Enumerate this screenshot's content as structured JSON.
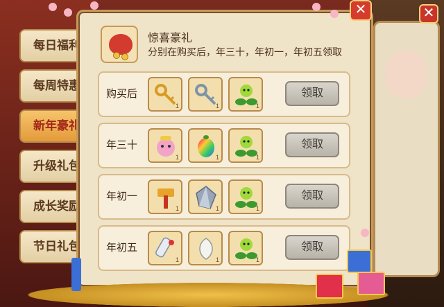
{
  "left_tabs": [
    {
      "label": "每日福利",
      "active": false
    },
    {
      "label": "每周特惠",
      "active": false
    },
    {
      "label": "新年豪礼",
      "active": true
    },
    {
      "label": "升级礼包",
      "active": false
    },
    {
      "label": "成长奖励",
      "active": false
    },
    {
      "label": "节日礼包",
      "active": false
    }
  ],
  "panel": {
    "title": "惊喜豪礼",
    "subtitle": "分别在购买后，年三十，年初一，年初五领取",
    "close_icon": "close-icon",
    "rows": [
      {
        "label": "购买后",
        "items": [
          {
            "icon": "gold-key-icon",
            "count": "1"
          },
          {
            "icon": "silver-key-icon",
            "count": "1"
          },
          {
            "icon": "green-sprout-icon",
            "count": "1"
          }
        ],
        "button": "领取"
      },
      {
        "label": "年三十",
        "items": [
          {
            "icon": "pink-pet-icon",
            "count": "1"
          },
          {
            "icon": "rainbow-egg-icon",
            "count": "1"
          },
          {
            "icon": "green-sprout-icon",
            "count": "1"
          }
        ],
        "button": "领取"
      },
      {
        "label": "年初一",
        "items": [
          {
            "icon": "golden-hammer-icon",
            "count": "1"
          },
          {
            "icon": "crystal-icon",
            "count": "1"
          },
          {
            "icon": "green-sprout-icon",
            "count": "1"
          }
        ],
        "button": "领取"
      },
      {
        "label": "年初五",
        "items": [
          {
            "icon": "scroll-icon",
            "count": "1"
          },
          {
            "icon": "white-gem-icon",
            "count": "1"
          },
          {
            "icon": "green-sprout-icon",
            "count": "1"
          }
        ],
        "button": "领取"
      }
    ]
  },
  "colors": {
    "accent": "#c59a5c",
    "button_gray": "#b9b3a8",
    "close_red": "#d63c2c",
    "tab_active": "#e39a3a"
  }
}
